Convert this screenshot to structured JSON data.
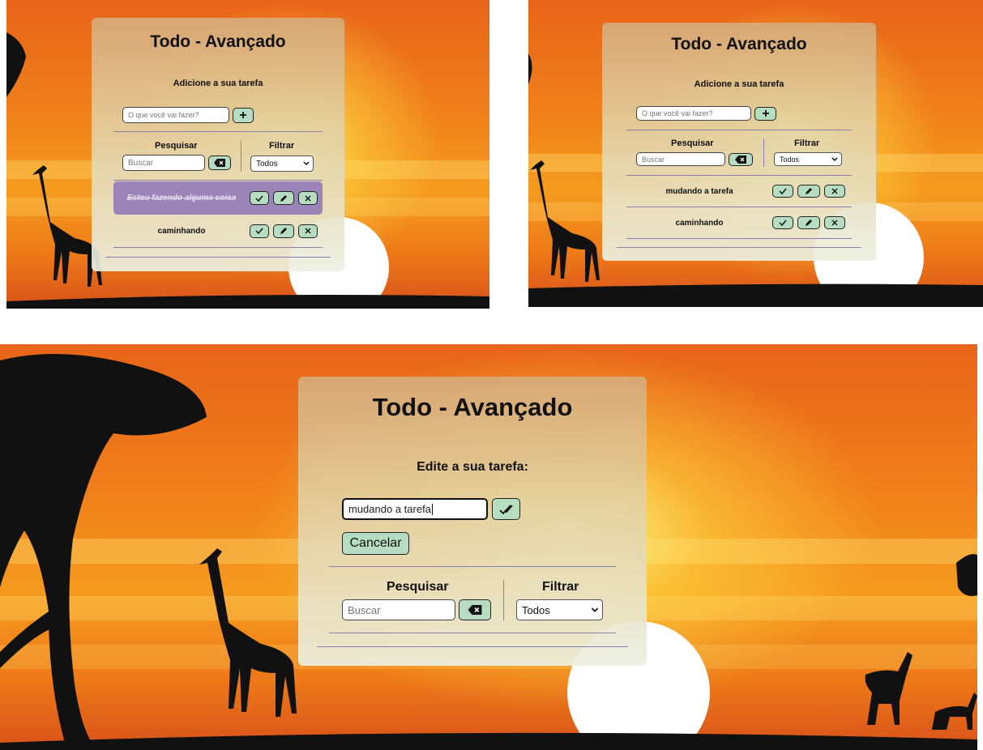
{
  "app": {
    "title": "Todo - Avançado",
    "add_subtitle": "Adicione a sua tarefa",
    "edit_subtitle": "Edite a sua tarefa:",
    "todo_placeholder": "O que você vai fazer?",
    "search_label": "Pesquisar",
    "search_placeholder": "Buscar",
    "filter_label": "Filtrar",
    "filter_selected": "Todos",
    "cancel_label": "Cancelar",
    "edit_value": "mudando a tarefa"
  },
  "screen1": {
    "todos": [
      {
        "title": "Estou fazendo alguma coisa",
        "done": true
      },
      {
        "title": "caminhando",
        "done": false
      }
    ]
  },
  "screen2": {
    "todos": [
      {
        "title": "mudando a tarefa",
        "done": false
      },
      {
        "title": "caminhando",
        "done": false
      }
    ]
  },
  "icons": {
    "add": "plus-icon",
    "clear_search": "backspace-icon",
    "done": "check-icon",
    "edit": "pencil-icon",
    "remove": "close-icon",
    "confirm_edit": "double-check-icon"
  },
  "colors": {
    "button_bg": "#b6dcc1",
    "done_item_bg": "#9b84b8",
    "separator": "#8c7fb3"
  }
}
